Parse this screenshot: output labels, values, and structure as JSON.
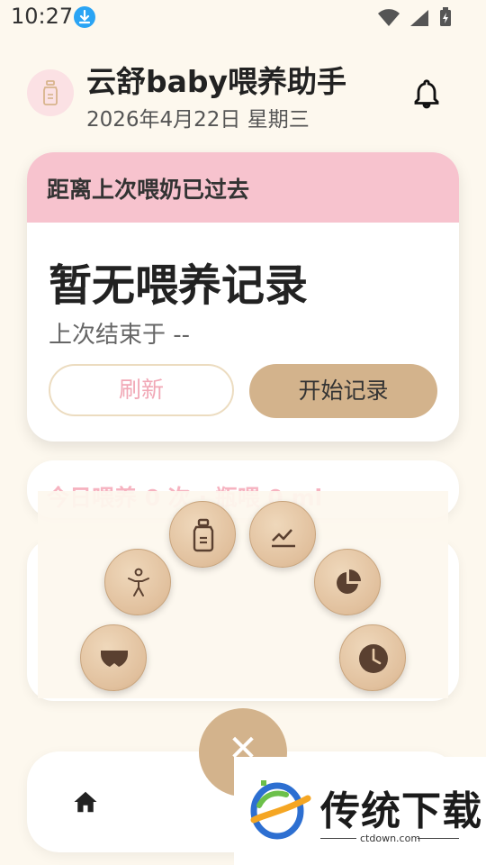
{
  "status_bar": {
    "time": "10:27"
  },
  "header": {
    "title": "云舒baby喂养助手",
    "date": "2026年4月22日 星期三"
  },
  "main_card": {
    "heading": "距离上次喂奶已过去",
    "status": "暂无喂养记录",
    "last_end": "上次结束于 --",
    "refresh_label": "刷新",
    "start_label": "开始记录"
  },
  "summary_card": {
    "text": "今日喂养 0 次 · 瓶喂 0 ml"
  },
  "radial_menu": {
    "items": [
      {
        "icon": "bottle-icon"
      },
      {
        "icon": "chart-icon"
      },
      {
        "icon": "baby-icon"
      },
      {
        "icon": "pie-chart-icon"
      },
      {
        "icon": "diaper-icon"
      },
      {
        "icon": "clock-icon"
      }
    ],
    "close_label": "✕"
  },
  "colors": {
    "background": "#fdf8ee",
    "card_header": "#f7c3ce",
    "accent": "#d3b38c",
    "refresh_text": "#f1a8b6"
  },
  "watermark": {
    "text": "传统下载",
    "url": "ctdown.com"
  }
}
